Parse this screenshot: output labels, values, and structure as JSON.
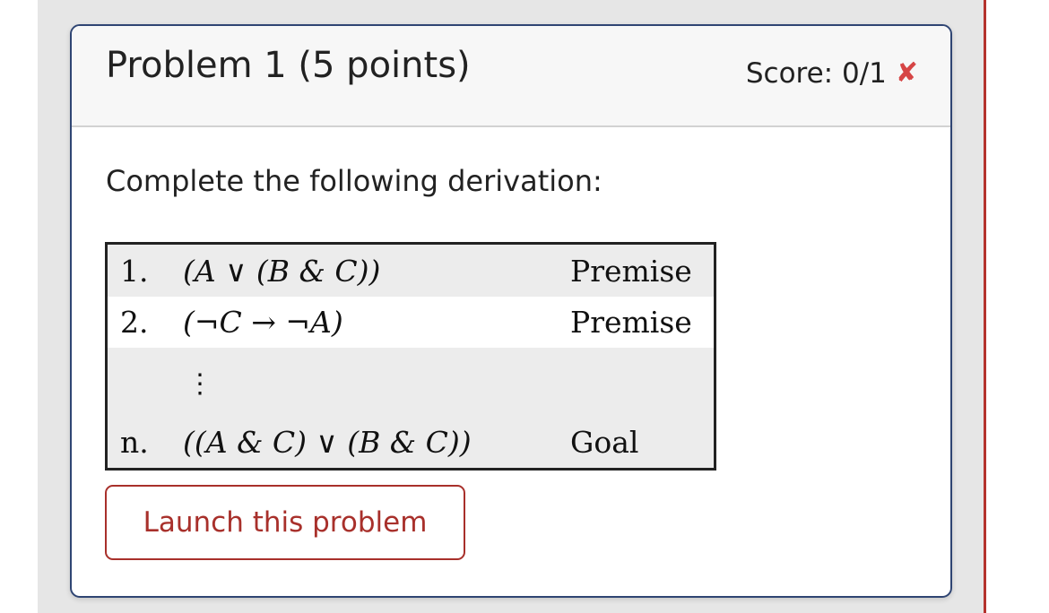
{
  "problem": {
    "title": "Problem 1 (5 points)",
    "score_label": "Score: 0/1",
    "score_icon": "cross-icon",
    "prompt": "Complete the following derivation:",
    "derivation": [
      {
        "num": "1.",
        "formula": "(A ∨ (B & C))",
        "justification": "Premise"
      },
      {
        "num": "2.",
        "formula": "(¬C → ¬A)",
        "justification": "Premise"
      },
      {
        "num": "",
        "formula": "⋮",
        "justification": ""
      },
      {
        "num": "n.",
        "formula": "((A & C) ∨ (B & C))",
        "justification": "Goal"
      }
    ],
    "launch_label": "Launch this problem"
  },
  "colors": {
    "card_border": "#2f4573",
    "accent_red": "#a8302b",
    "score_x": "#d64545",
    "row_shade": "#ececec"
  }
}
